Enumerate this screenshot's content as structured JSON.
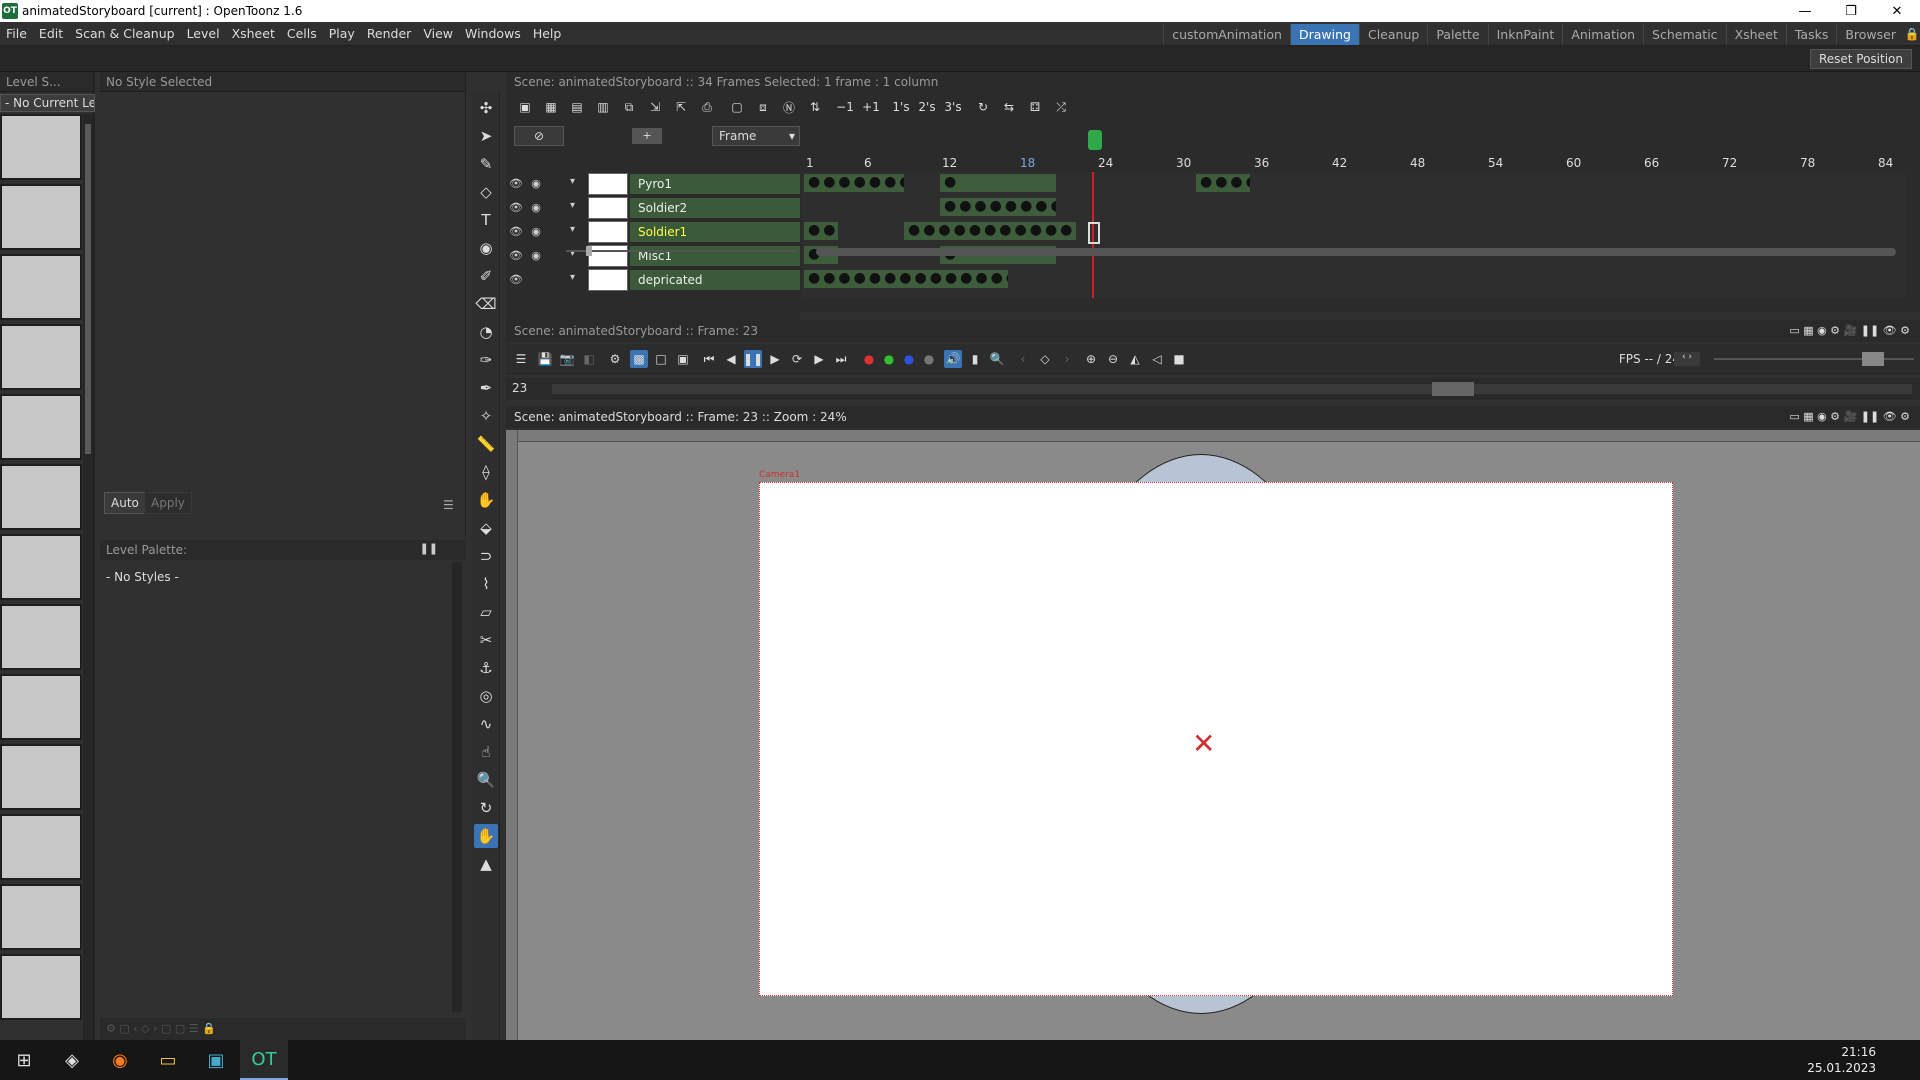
{
  "window": {
    "title": "animatedStoryboard [current] : OpenToonz 1.6",
    "app_icon": "OT"
  },
  "menu": [
    "File",
    "Edit",
    "Scan & Cleanup",
    "Level",
    "Xsheet",
    "Cells",
    "Play",
    "Render",
    "View",
    "Windows",
    "Help"
  ],
  "rooms": [
    "customAnimation",
    "Drawing",
    "Cleanup",
    "Palette",
    "InknPaint",
    "Animation",
    "Schematic",
    "Xsheet",
    "Tasks",
    "Browser"
  ],
  "active_room": "Drawing",
  "reset_position": "Reset Position",
  "level_strip": {
    "title": "Level S...",
    "current": "- No Current Le"
  },
  "style_editor": {
    "title": "No Style Selected",
    "auto": "Auto",
    "apply": "Apply"
  },
  "level_palette": {
    "title": "Level Palette:",
    "empty": "- No Styles -"
  },
  "xsheet": {
    "header": "Scene: animatedStoryboard  ::  34 Frames  Selected: 1 frame : 1 column",
    "mode": "Frame",
    "minus_one": "−1",
    "plus_one": "+1",
    "s1": "1's",
    "s2": "2's",
    "s3": "3's",
    "frame_numbers": [
      "1",
      "6",
      "12",
      "18",
      "24",
      "30",
      "36",
      "42",
      "48",
      "54",
      "60",
      "66",
      "72",
      "78",
      "84"
    ],
    "current_frame": "23",
    "layers": [
      {
        "name": "Pyro1"
      },
      {
        "name": "Soldier2"
      },
      {
        "name": "Soldier1",
        "selected": true
      },
      {
        "name": "Misc1"
      },
      {
        "name": "depricated"
      }
    ]
  },
  "viewer1": {
    "header": "Scene: animatedStoryboard  ::  Frame: 23"
  },
  "playback": {
    "fps": "FPS -- / 24",
    "frame": "23"
  },
  "viewer2": {
    "header": "Scene: animatedStoryboard  ::  Frame: 23  ::  Zoom : 24%",
    "camera": "Camera1"
  },
  "clock": {
    "time": "21:16",
    "date": "25.01.2023"
  },
  "colors": {
    "accent": "#3b74b5",
    "cell": "#3d5d3d",
    "cursor": "#d02020"
  }
}
